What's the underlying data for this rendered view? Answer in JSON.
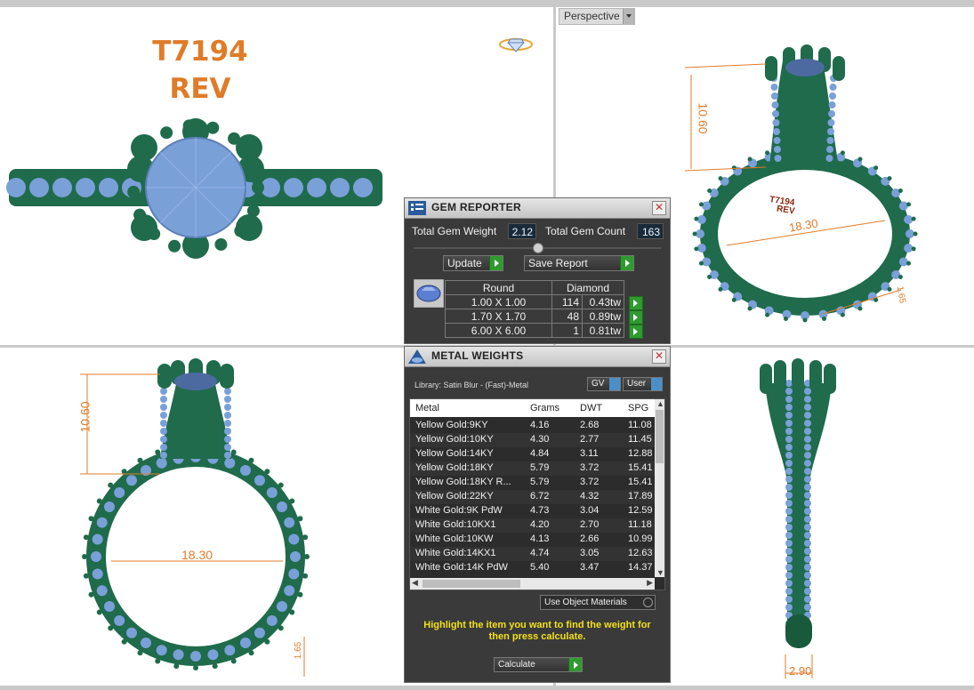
{
  "model": {
    "title_line1": "T7194",
    "title_line2": "REV",
    "engraving_line1": "T7194",
    "engraving_line2": "REV"
  },
  "viewport": {
    "projection": "Perspective"
  },
  "dimensions": {
    "tr_height": "10.60",
    "tr_width": "18.30",
    "tr_band": "1.65",
    "bl_height": "10.60",
    "bl_width": "18.30",
    "bl_band": "1.65",
    "br_width": "2.90"
  },
  "gem_reporter": {
    "title": "GEM REPORTER",
    "total_weight_label": "Total Gem Weight",
    "total_weight_value": "2.12",
    "total_count_label": "Total Gem Count",
    "total_count_value": "163",
    "update_label": "Update",
    "save_label": "Save Report",
    "col_shape": "Round",
    "col_material": "Diamond",
    "rows": [
      {
        "size": "1.00 X 1.00",
        "count": "114",
        "tw": "0.43tw"
      },
      {
        "size": "1.70 X 1.70",
        "count": "48",
        "tw": "0.89tw"
      },
      {
        "size": "6.00 X 6.00",
        "count": "1",
        "tw": "0.81tw"
      }
    ]
  },
  "metal_weights": {
    "title": "METAL WEIGHTS",
    "library": "Library: Satin Blur - (Fast)-Metal",
    "gv_label": "GV",
    "user_label": "User",
    "columns": [
      "Metal",
      "Grams",
      "DWT",
      "SPG"
    ],
    "rows": [
      {
        "metal": "Yellow Gold:9KY",
        "grams": "4.16",
        "dwt": "2.68",
        "spg": "11.08"
      },
      {
        "metal": "Yellow Gold:10KY",
        "grams": "4.30",
        "dwt": "2.77",
        "spg": "11.45"
      },
      {
        "metal": "Yellow Gold:14KY",
        "grams": "4.84",
        "dwt": "3.11",
        "spg": "12.88"
      },
      {
        "metal": "Yellow Gold:18KY",
        "grams": "5.79",
        "dwt": "3.72",
        "spg": "15.41"
      },
      {
        "metal": "Yellow Gold:18KY R...",
        "grams": "5.79",
        "dwt": "3.72",
        "spg": "15.41"
      },
      {
        "metal": "Yellow Gold:22KY",
        "grams": "6.72",
        "dwt": "4.32",
        "spg": "17.89"
      },
      {
        "metal": "White Gold:9K PdW",
        "grams": "4.73",
        "dwt": "3.04",
        "spg": "12.59"
      },
      {
        "metal": "White Gold:10KX1",
        "grams": "4.20",
        "dwt": "2.70",
        "spg": "11.18"
      },
      {
        "metal": "White Gold:10KW",
        "grams": "4.13",
        "dwt": "2.66",
        "spg": "10.99"
      },
      {
        "metal": "White Gold:14KX1",
        "grams": "4.74",
        "dwt": "3.05",
        "spg": "12.63"
      },
      {
        "metal": "White Gold:14K PdW",
        "grams": "5.40",
        "dwt": "3.47",
        "spg": "14.37"
      }
    ],
    "use_object_materials": "Use Object Materials",
    "hint": "Highlight the item you want to find the weight for then press calculate.",
    "calculate_label": "Calculate"
  },
  "colors": {
    "metal_green": "#1f6b4c",
    "gem_blue": "#7aa0d8",
    "dimension_orange": "#e07b28",
    "panel_bg": "#3a3a3a",
    "panel_value_text": "#e8f4ff",
    "hint_yellow": "#f2e01a",
    "accent_button_green": "#2f9a2f"
  },
  "icons": [
    "ring-logo-icon",
    "gem-reporter-icon",
    "metal-weights-icon",
    "close-icon",
    "play-icon",
    "dropdown-arrow-icon",
    "toggle-icon"
  ]
}
